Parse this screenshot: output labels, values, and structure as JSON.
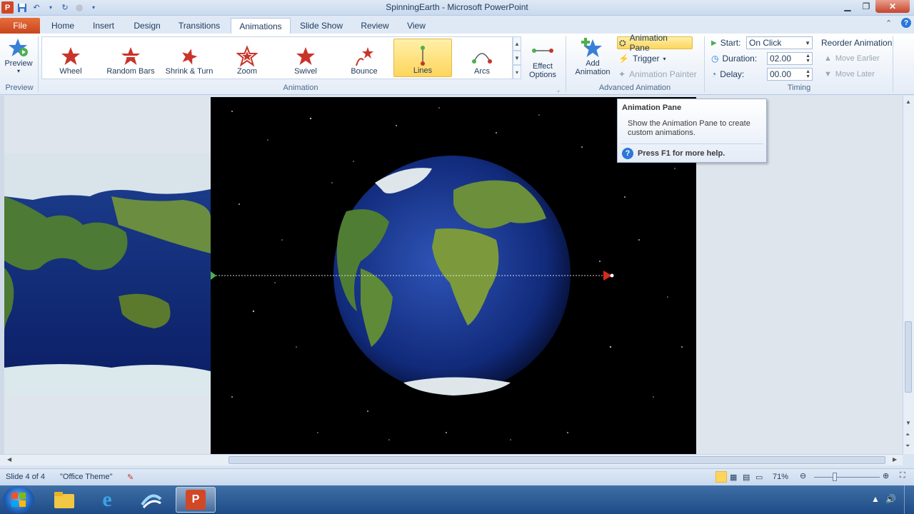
{
  "window": {
    "title": "SpinningEarth  -  Microsoft PowerPoint",
    "app_icon": "P"
  },
  "quick_access": {
    "save_icon": "save-icon",
    "undo_icon": "undo-icon",
    "redo_icon": "redo-icon",
    "customize_icon": "chevron-down-icon"
  },
  "tabs": {
    "file": "File",
    "items": [
      "Home",
      "Insert",
      "Design",
      "Transitions",
      "Animations",
      "Slide Show",
      "Review",
      "View"
    ],
    "active": "Animations"
  },
  "ribbon": {
    "preview": {
      "label": "Preview",
      "group": "Preview"
    },
    "animation_group": "Animation",
    "animations": [
      "Wheel",
      "Random Bars",
      "Shrink & Turn",
      "Zoom",
      "Swivel",
      "Bounce",
      "Lines",
      "Arcs"
    ],
    "selected_animation": "Lines",
    "effect_options": {
      "line1": "Effect",
      "line2": "Options"
    },
    "advanced": {
      "group": "Advanced Animation",
      "add_animation_1": "Add",
      "add_animation_2": "Animation",
      "animation_pane": "Animation Pane",
      "trigger": "Trigger",
      "animation_painter": "Animation Painter"
    },
    "timing": {
      "group": "Timing",
      "start_label": "Start:",
      "start_value": "On Click",
      "duration_label": "Duration:",
      "duration_value": "02.00",
      "delay_label": "Delay:",
      "delay_value": "00.00",
      "reorder": "Reorder Animation",
      "move_earlier": "Move Earlier",
      "move_later": "Move Later"
    }
  },
  "tooltip": {
    "title": "Animation Pane",
    "body": "Show the Animation Pane to create custom animations.",
    "help": "Press F1 for more help."
  },
  "status": {
    "slide": "Slide 4 of 4",
    "theme": "\"Office Theme\"",
    "zoom": "71%"
  },
  "colors": {
    "accent": "#2a5db0",
    "file_tab": "#c8461d",
    "selected": "#fdd55c"
  }
}
